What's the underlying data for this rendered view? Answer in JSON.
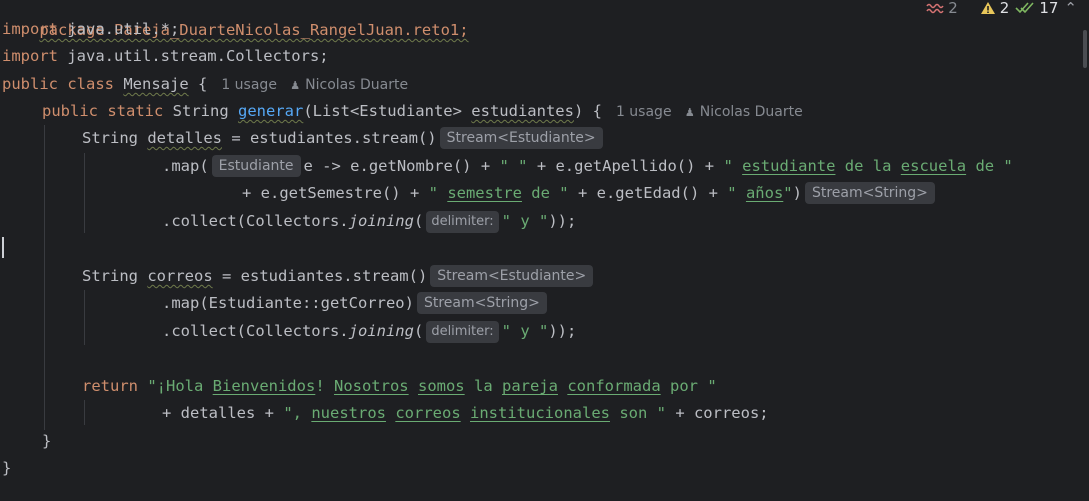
{
  "status": {
    "errors": "2",
    "warnings": "2",
    "checks": "17"
  },
  "code": {
    "l0": "package Pareja_DuarteNicolas_RangelJuan.reto1;",
    "l1a": "import ",
    "l1b": "java.util.*;",
    "l2a": "import ",
    "l2b": "java.util.stream.Collectors;",
    "l3a": "public class ",
    "l3b": "Mensaje",
    "l3c": " {",
    "l3usage": "1 usage",
    "l3author": "Nicolas Duarte",
    "l4a": "public static ",
    "l4b": "String ",
    "l4c": "generar",
    "l4d": "(List<Estudiante> ",
    "l4e": "estudiantes",
    "l4f": ") {",
    "l4usage": "1 usage",
    "l4author": "Nicolas Duarte",
    "l5a": "String ",
    "l5b": "detalles",
    "l5c": " = estudiantes.stream()",
    "l5hint": "Stream<Estudiante>",
    "l6a": ".map(",
    "l6hint": "Estudiante",
    "l6b": "e -> e.getNombre() + ",
    "l6c": "\" \"",
    "l6d": " + e.getApellido() + ",
    "l6e": "\" ",
    "l6f": "estudiante",
    "l6g": " de la ",
    "l6h": "escuela",
    "l6i": " de \"",
    "l7a": "+ e.getSemestre() + ",
    "l7b": "\" ",
    "l7c": "semestre",
    "l7d": " de \"",
    "l7e": " + e.getEdad() + ",
    "l7f": "\" ",
    "l7g": "años",
    "l7h": "\"",
    "l7i": ")",
    "l7hint": "Stream<String>",
    "l8a": ".collect(Collectors.",
    "l8b": "joining",
    "l8c": "(",
    "l8hint": "delimiter:",
    "l8d": "\" y \"",
    "l8e": "));",
    "l10a": "String ",
    "l10b": "correos",
    "l10c": " = estudiantes.stream()",
    "l10hint": "Stream<Estudiante>",
    "l11a": ".map(Estudiante::getCorreo)",
    "l11hint": "Stream<String>",
    "l12a": ".collect(Collectors.",
    "l12b": "joining",
    "l12c": "(",
    "l12hint": "delimiter:",
    "l12d": "\" y \"",
    "l12e": "));",
    "l14a": "return ",
    "l14b": "\"¡Hola ",
    "l14c": "Bienvenidos",
    "l14d": "! ",
    "l14e": "Nosotros",
    "l14f": " ",
    "l14g": "somos",
    "l14h": " la ",
    "l14i": "pareja",
    "l14j": " ",
    "l14k": "conformada",
    "l14l": " por \"",
    "l15a": "+ detalles + ",
    "l15b": "\", ",
    "l15c": "nuestros",
    "l15d": " ",
    "l15e": "correos",
    "l15f": " ",
    "l15g": "institucionales",
    "l15h": " son \"",
    "l15i": " + correos;",
    "l16": "}",
    "l17": "}"
  }
}
